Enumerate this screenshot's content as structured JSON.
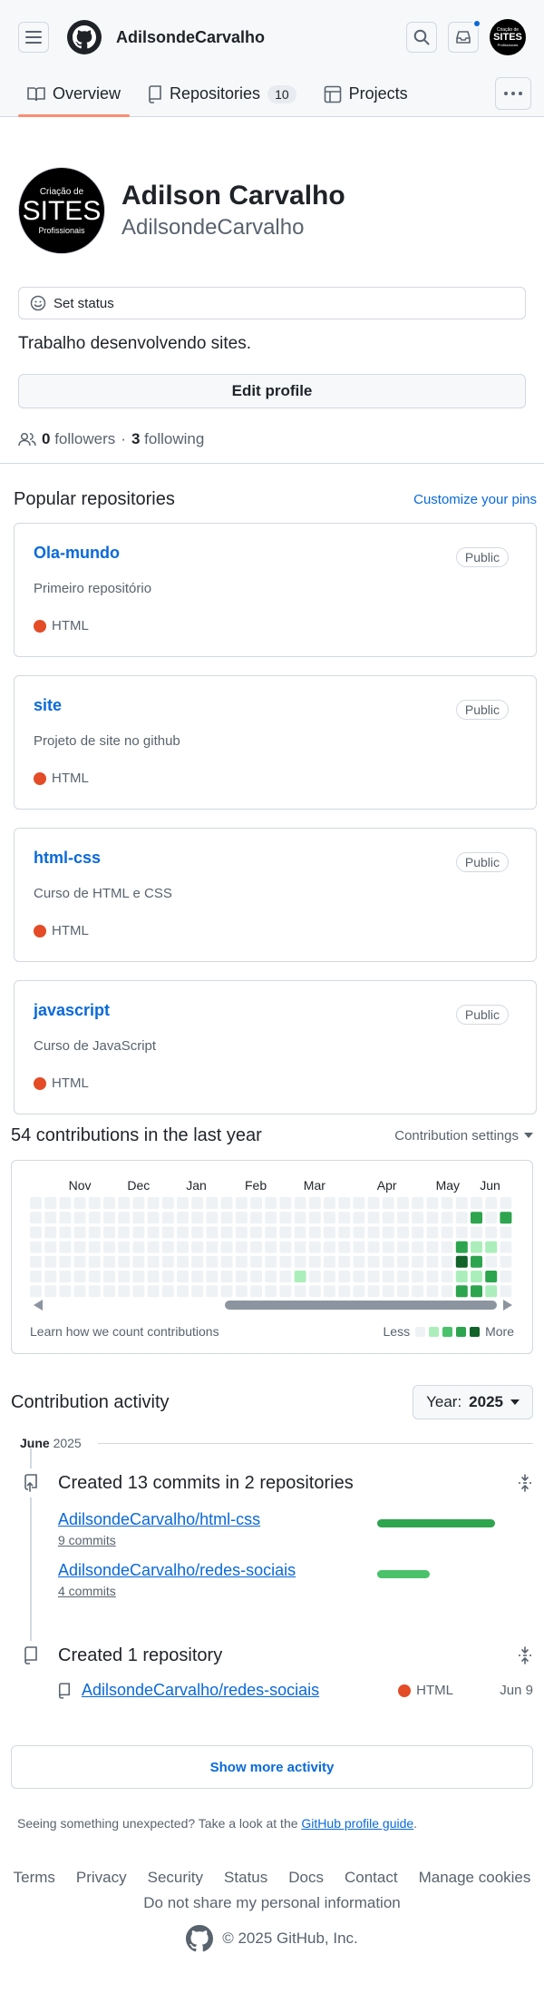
{
  "header": {
    "username": "AdilsondeCarvalho",
    "avatar_text_top": "Criação de",
    "avatar_text_main": "SITES",
    "avatar_text_bottom": "Profissionais"
  },
  "tabs": [
    {
      "label": "Overview",
      "count": ""
    },
    {
      "label": "Repositories",
      "count": "10"
    },
    {
      "label": "Projects",
      "count": ""
    }
  ],
  "profile": {
    "fullname": "Adilson Carvalho",
    "login": "AdilsondeCarvalho",
    "set_status": "Set status",
    "bio": "Trabalho desenvolvendo sites.",
    "edit_profile": "Edit profile",
    "followers_count": "0",
    "followers_label": "followers",
    "separator": "·",
    "following_count": "3",
    "following_label": "following"
  },
  "popular": {
    "title": "Popular repositories",
    "customize": "Customize your pins",
    "repos": [
      {
        "name": "Ola-mundo",
        "visibility": "Public",
        "description": "Primeiro repositório",
        "language": "HTML"
      },
      {
        "name": "site",
        "visibility": "Public",
        "description": "Projeto de site no github",
        "language": "HTML"
      },
      {
        "name": "html-css",
        "visibility": "Public",
        "description": "Curso de HTML e CSS",
        "language": "HTML"
      },
      {
        "name": "javascript",
        "visibility": "Public",
        "description": "Curso de JavaScript",
        "language": "HTML"
      }
    ],
    "lang_color": "#e34c26"
  },
  "contributions": {
    "title": "54 contributions in the last year",
    "settings": "Contribution settings",
    "months": [
      "Nov",
      "Dec",
      "Jan",
      "Feb",
      "Mar",
      "Apr",
      "May",
      "Jun"
    ],
    "learn": "Learn how we count contributions",
    "less": "Less",
    "more": "More",
    "levels": [
      "#eff2f5",
      "#aceebb",
      "#4ac26b",
      "#2da44e",
      "#116329"
    ],
    "active_cells": [
      {
        "week": 18,
        "day": 5,
        "level": 1
      },
      {
        "week": 29,
        "day": 3,
        "level": 3
      },
      {
        "week": 29,
        "day": 4,
        "level": 4
      },
      {
        "week": 29,
        "day": 5,
        "level": 1
      },
      {
        "week": 29,
        "day": 6,
        "level": 3
      },
      {
        "week": 30,
        "day": 1,
        "level": 3
      },
      {
        "week": 30,
        "day": 3,
        "level": 1
      },
      {
        "week": 30,
        "day": 4,
        "level": 3
      },
      {
        "week": 30,
        "day": 5,
        "level": 1
      },
      {
        "week": 30,
        "day": 6,
        "level": 3
      },
      {
        "week": 31,
        "day": 3,
        "level": 1
      },
      {
        "week": 31,
        "day": 5,
        "level": 3
      },
      {
        "week": 31,
        "day": 6,
        "level": 1
      },
      {
        "week": 32,
        "day": 1,
        "level": 3
      }
    ]
  },
  "activity": {
    "title": "Contribution activity",
    "year_prefix": "Year:",
    "year": "2025",
    "month": "June",
    "month_year": "2025",
    "commits_title": "Created 13 commits in 2 repositories",
    "commit_repos": [
      {
        "name": "AdilsondeCarvalho/html-css",
        "count": "9 commits",
        "share": 0.69,
        "color": "#2da44e"
      },
      {
        "name": "AdilsondeCarvalho/redes-sociais",
        "count": "4 commits",
        "share": 0.31,
        "color": "#4ac26b"
      }
    ],
    "repo_title": "Created 1 repository",
    "created_repo": {
      "name": "AdilsondeCarvalho/redes-sociais",
      "language": "HTML",
      "date": "Jun 9"
    },
    "show_more": "Show more activity",
    "unexpected_text": "Seeing something unexpected? Take a look at the",
    "guide_link": "GitHub profile guide",
    "period": "."
  },
  "footer": {
    "links": [
      "Terms",
      "Privacy",
      "Security",
      "Status",
      "Docs",
      "Contact",
      "Manage cookies"
    ],
    "dnsmpi": "Do not share my personal information",
    "copyright": "© 2025 GitHub, Inc."
  }
}
